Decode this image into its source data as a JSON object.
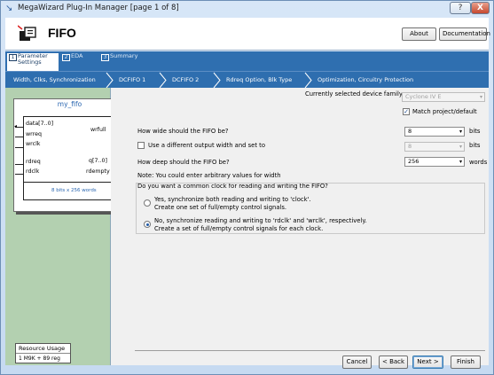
{
  "window": {
    "title": "MegaWizard Plug-In Manager [page 1 of 8]",
    "help_label": "?",
    "close_label": "X"
  },
  "header": {
    "title": "FIFO",
    "about_label": "About",
    "documentation_label": "Documentation"
  },
  "page_tabs": [
    {
      "num": "1",
      "label": "Parameter Settings",
      "active": true
    },
    {
      "num": "2",
      "label": "EDA",
      "active": false
    },
    {
      "num": "3",
      "label": "Summary",
      "active": false
    }
  ],
  "sub_steps": [
    "Width, Clks, Synchronization",
    "DCFIFO 1",
    "DCFIFO 2",
    "Rdreq Option, Blk Type",
    "Optimization, Circuitry Protection"
  ],
  "symbol": {
    "name": "my_fifo",
    "pins_left": [
      "data[7..0]",
      "wrreq",
      "wrclk",
      "rdreq",
      "rdclk"
    ],
    "pins_right": [
      "wrfull",
      "q[7..0]",
      "rdempty"
    ],
    "note": "8 bits x 256 words"
  },
  "resource": {
    "title": "Resource Usage",
    "value": "1 M9K + 89 reg"
  },
  "form": {
    "device_family_label": "Currently selected device family:",
    "device_family_value": "Cyclone IV E",
    "match_project_label": "Match project/default",
    "width_question": "How wide should the FIFO be?",
    "width_value": "8",
    "width_unit": "bits",
    "diff_output_label": "Use a different output width and set to",
    "diff_output_value": "8",
    "diff_output_unit": "bits",
    "depth_question": "How deep should the FIFO be?",
    "depth_value": "256",
    "depth_unit": "words",
    "note": "Note: You could enter arbitrary values for width",
    "clock_question": "Do you want a common clock for reading and writing the FIFO?",
    "option1_line1": "Yes, synchronize both reading and writing to 'clock'.",
    "option1_line2": "Create one set of full/empty control signals.",
    "option2_line1": "No, synchronize reading and writing to 'rdclk' and 'wrclk', respectively.",
    "option2_line2": "Create a set of full/empty control signals for each clock."
  },
  "footer": {
    "cancel_label": "Cancel",
    "back_label": "< Back",
    "next_label": "Next >",
    "finish_label": "Finish"
  }
}
